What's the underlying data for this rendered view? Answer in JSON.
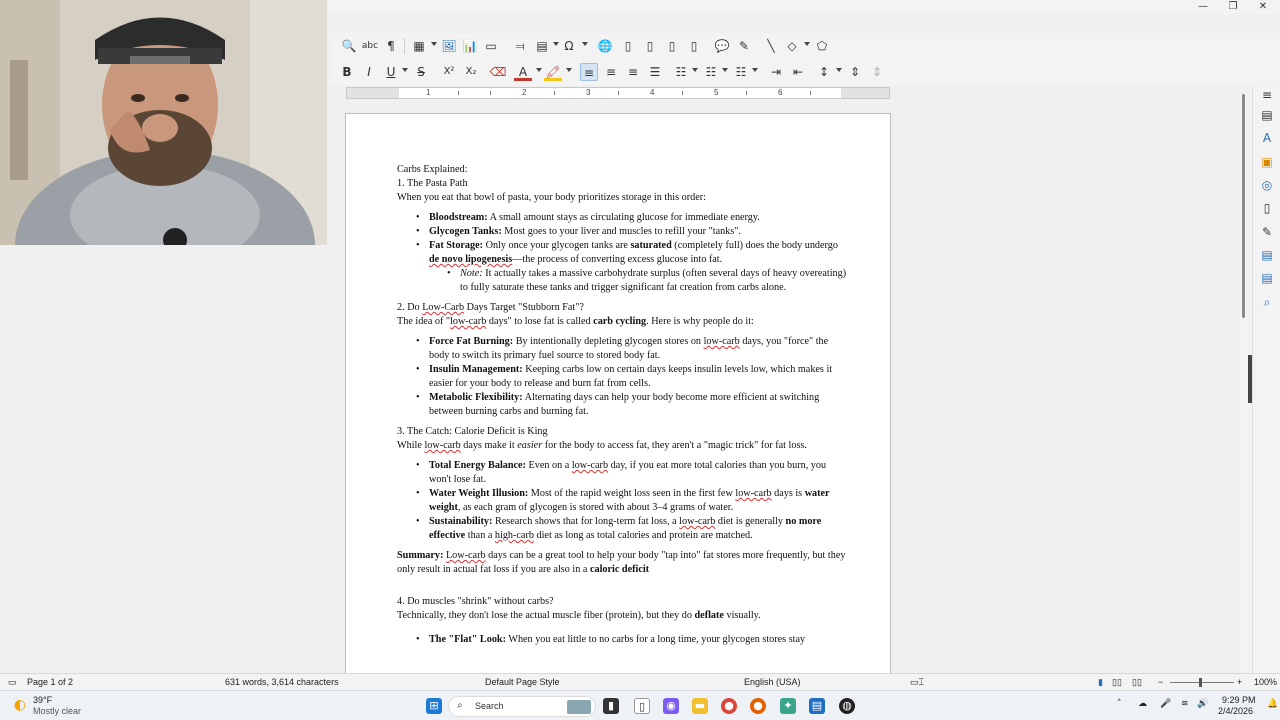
{
  "document": {
    "heading": "Carbs Explained:",
    "s1": {
      "title": "1. The Pasta Path",
      "intro": "When you eat that bowl of pasta, your body prioritizes storage in this order:",
      "b1_label": "Bloodstream:",
      "b1_text": " A small amount stays as circulating glucose for immediate energy.",
      "b2_label": "Glycogen Tanks:",
      "b2_text": " Most goes to your liver and muscles to refill your \"tanks\".",
      "b3_label": "Fat Storage:",
      "b3_text1": " Only once your glycogen tanks are ",
      "b3_saturated": "saturated",
      "b3_text2": " (completely full) does the body undergo ",
      "b3_denovo": "de novo lipogenesis",
      "b3_text3": "—the process of converting excess glucose into fat.",
      "note_label": "Note:",
      "note_text": " It actually takes a massive carbohydrate surplus (often several days of heavy overeating) to fully saturate these tanks and trigger significant fat creation from carbs alone."
    },
    "s2": {
      "title_pre": "2. Do ",
      "title_lowcarb": "Low-Carb",
      "title_post": " Days Target \"Stubborn Fat\"?",
      "intro_pre": "The idea of \"",
      "intro_lowcarb": "low-carb",
      "intro_mid": " days\" to lose fat is called ",
      "intro_bold": "carb cycling",
      "intro_post": ". Here is why people do it:",
      "b1_label": "Force Fat Burning:",
      "b1_text1": " By intentionally depleting glycogen stores on ",
      "b1_lowcarb": "low-carb",
      "b1_text2": " days, you \"force\" the body to switch its primary fuel source to stored body fat.",
      "b2_label": "Insulin Management:",
      "b2_text": " Keeping carbs low on certain days keeps insulin levels low, which makes it easier for your body to release and burn fat from cells.",
      "b3_label": "Metabolic Flexibility:",
      "b3_text": " Alternating days can help your body become more efficient at switching between burning carbs and burning fat."
    },
    "s3": {
      "title": "3. The Catch: Calorie Deficit is King",
      "intro_pre": "While ",
      "intro_lowcarb": "low-carb",
      "intro_mid": " days make it ",
      "intro_italic": "easier",
      "intro_post": " for the body to access fat, they aren't a \"magic trick\" for fat loss.",
      "b1_label": "Total Energy Balance:",
      "b1_text1": " Even on a ",
      "b1_lowcarb": "low-carb",
      "b1_text2": " day, if you eat more total calories than you burn, you won't lose fat.",
      "b2_label": "Water Weight Illusion:",
      "b2_text1": " Most of the rapid weight loss seen in the first few ",
      "b2_lowcarb": "low-carb",
      "b2_text2": " days is ",
      "b2_bold": "water weight",
      "b2_text3": ", as each gram of glycogen is stored with about 3–4 grams of water.",
      "b3_label": "Sustainability:",
      "b3_text1": " Research shows that for long-term fat loss, a ",
      "b3_lowcarb": "low-carb",
      "b3_text2": " diet is generally ",
      "b3_bold": "no more effective",
      "b3_text3": " than a ",
      "b3_highcarb": "high-carb",
      "b3_text4": " diet as long as total calories and protein are matched."
    },
    "summary": {
      "label": "Summary:",
      "lowcarb": "Low-carb",
      "text1": " days can be a great tool to help your body \"tap into\" fat stores more frequently, but they only result in actual fat loss if you are also in a ",
      "bold": "caloric deficit"
    },
    "s4": {
      "title": "4. Do muscles \"shrink\" without carbs?",
      "intro_pre": "Technically, they don't lose the actual muscle fiber (protein), but they do ",
      "intro_bold": "deflate",
      "intro_post": " visually.",
      "b1_label": "The \"Flat\" Look:",
      "b1_text": " When you eat little to no carbs for a long time, your glycogen stores stay"
    }
  },
  "ruler": {
    "numbers": [
      "1",
      "2",
      "3",
      "4",
      "5",
      "6"
    ]
  },
  "statusbar": {
    "page": "Page 1 of 2",
    "words": "631 words, 3,614 characters",
    "style": "Default Page Style",
    "language": "English (USA)",
    "zoom": "100%"
  },
  "taskbar": {
    "temp": "39°F",
    "weather": "Mostly clear",
    "search": "Search",
    "time": "9:29 PM",
    "date": "2/4/2026"
  },
  "colors": {
    "accent": "#2a6db5",
    "font_color": "#c0392b",
    "highlight": "#f5c518"
  }
}
